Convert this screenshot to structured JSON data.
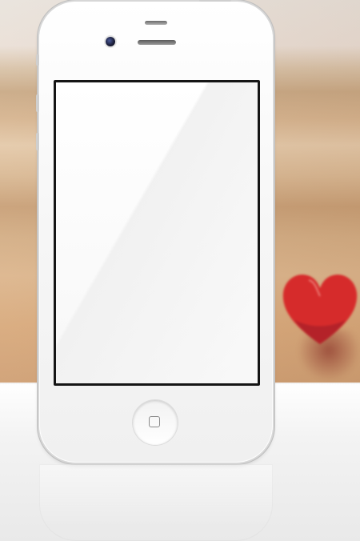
{
  "scene": {
    "backdrop": "blurred-beach-background",
    "decoration": "red-heart-shape"
  },
  "device": {
    "type": "phone",
    "color": "#ffffff",
    "screen_color": "#ffffff",
    "screen_border_color": "#151515"
  },
  "colors": {
    "heart": "#d62b2b",
    "heart_dark": "#a51f2a",
    "floor": "#f1f1f1"
  },
  "icons": {
    "home": "home-square-icon",
    "camera": "front-camera-icon",
    "speaker": "earpiece-speaker-icon"
  }
}
